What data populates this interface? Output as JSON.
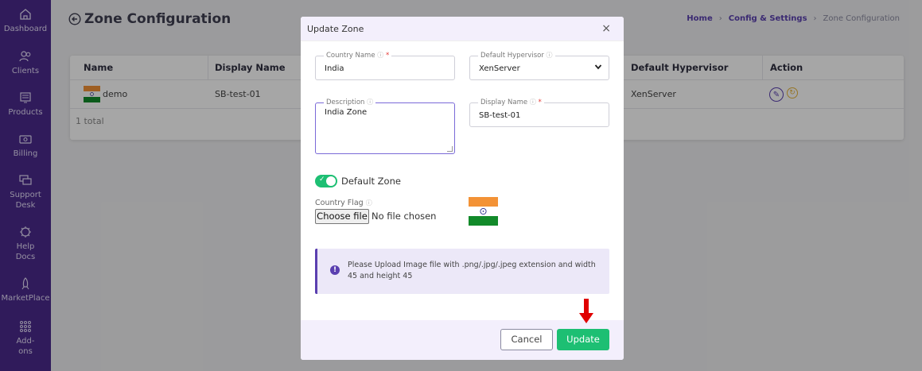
{
  "sidebar": {
    "items": [
      {
        "label": "Dashboard",
        "icon": "home-icon"
      },
      {
        "label": "Clients",
        "icon": "users-icon"
      },
      {
        "label": "Products",
        "icon": "products-icon"
      },
      {
        "label": "Billing",
        "icon": "billing-icon"
      },
      {
        "label": "Support Desk",
        "icon": "support-icon"
      },
      {
        "label": "Help Docs",
        "icon": "help-icon"
      },
      {
        "label": "MarketPlace",
        "icon": "rocket-icon"
      },
      {
        "label": "Add-ons",
        "icon": "grid-icon"
      }
    ]
  },
  "page": {
    "title": "Zone Configuration",
    "breadcrumb": [
      "Home",
      "Config & Settings",
      "Zone Configuration"
    ],
    "table": {
      "headers": [
        "Name",
        "Display Name",
        "Default Hypervisor",
        "Action"
      ],
      "row": {
        "name": "demo",
        "display_name": "SB-test-01",
        "hypervisor": "XenServer"
      },
      "total": "1 total"
    }
  },
  "modal": {
    "title": "Update Zone",
    "close": "×",
    "country_name": {
      "label": "Country Name",
      "value": "India"
    },
    "default_hypervisor": {
      "label": "Default Hypervisor",
      "value": "XenServer"
    },
    "description": {
      "label": "Description",
      "value": "India Zone"
    },
    "display_name": {
      "label": "Display Name",
      "value": "SB-test-01"
    },
    "default_zone": {
      "label": "Default Zone",
      "checked": true
    },
    "country_flag": {
      "label": "Country Flag",
      "button": "Choose file",
      "status": "No file chosen"
    },
    "info": "Please Upload Image file with .png/.jpg/.jpeg extension and width 45 and height 45",
    "cancel_label": "Cancel",
    "update_label": "Update"
  },
  "colors": {
    "sidebar": "#4a2a8c",
    "accent": "#5a3fb0",
    "success": "#1dbf73",
    "arrow": "#e00000"
  }
}
